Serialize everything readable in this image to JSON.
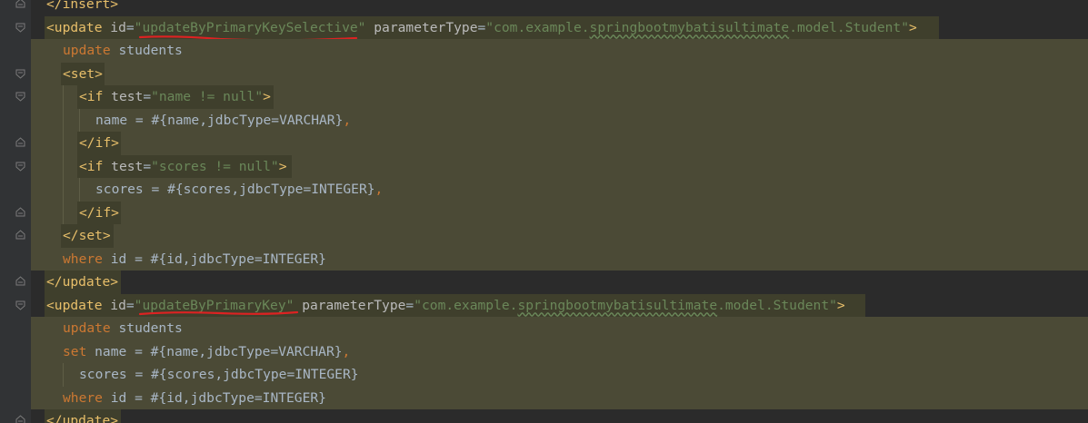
{
  "colors": {
    "background": "#2b2b2b",
    "gutter": "#313335",
    "highlight": "#4b4a36",
    "tag": "#e8bf6a",
    "string": "#6a8759",
    "keyword": "#cc7832",
    "text": "#a9b7c6",
    "annotation_marker": "#d22"
  },
  "icons": {
    "fold_open": "fold-open-icon",
    "fold_close": "fold-close-icon"
  },
  "lines": [
    {
      "t": "</insert>"
    },
    {
      "tag_open": "<update ",
      "attr1": "id",
      "eq1": "=",
      "val1": "\"updateByPrimaryKeySelective\"",
      "attr2": " parameterType",
      "eq2": "=",
      "val2a": "\"com.example.",
      "val2b": "springbootmybatisultimate",
      "val2c": ".model.Student\"",
      "close": ">"
    },
    {
      "kw": "update",
      "rest": " students"
    },
    {
      "tag": "<set>"
    },
    {
      "tag_open": "<if ",
      "attr1": "test",
      "eq1": "=",
      "val1": "\"name != null\"",
      "close": ">"
    },
    {
      "plain": "name = #{name,jdbcType=VARCHAR}",
      "comma": ","
    },
    {
      "tag": "</if>"
    },
    {
      "tag_open": "<if ",
      "attr1": "test",
      "eq1": "=",
      "val1": "\"scores != null\"",
      "close": ">"
    },
    {
      "plain": "scores = #{scores,jdbcType=INTEGER}",
      "comma": ","
    },
    {
      "tag": "</if>"
    },
    {
      "tag": "</set>"
    },
    {
      "kw": "where",
      "rest": " id = #{id,jdbcType=INTEGER}"
    },
    {
      "tag": "</update>"
    },
    {
      "tag_open": "<update ",
      "attr1": "id",
      "eq1": "=",
      "val1": "\"updateByPrimaryKey\"",
      "attr2": " parameterType",
      "eq2": "=",
      "val2a": "\"com.example.",
      "val2b": "springbootmybatisultimate",
      "val2c": ".model.Student\"",
      "close": ">"
    },
    {
      "kw": "update",
      "rest": " students"
    },
    {
      "kw": "set",
      "rest": " name = #{name,jdbcType=VARCHAR}",
      "comma": ","
    },
    {
      "plain": "scores = #{scores,jdbcType=INTEGER}"
    },
    {
      "kw": "where",
      "rest": " id = #{id,jdbcType=INTEGER}"
    },
    {
      "tag": "</update>"
    }
  ]
}
